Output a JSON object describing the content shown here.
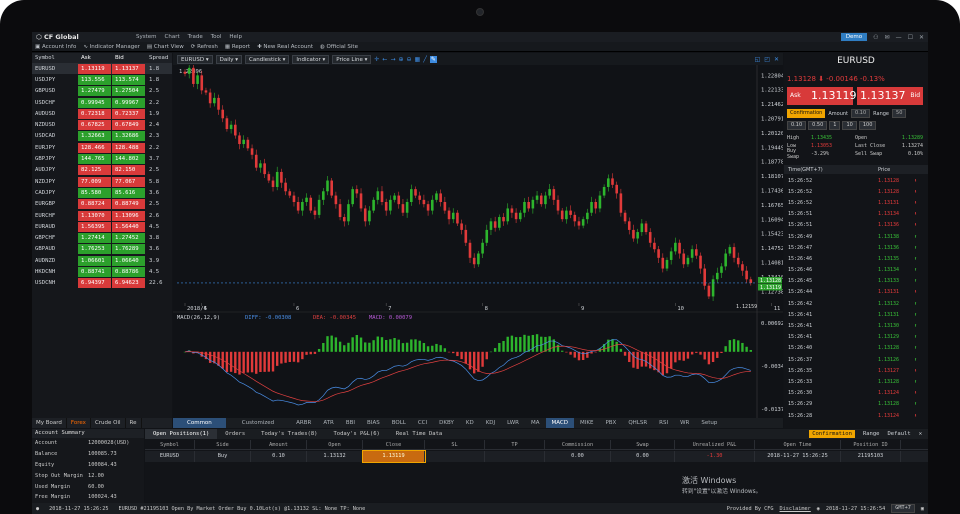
{
  "app": {
    "title": "CF Global"
  },
  "menu": [
    "System",
    "Chart",
    "Trade",
    "Tool",
    "Help"
  ],
  "titlebar_right": {
    "user": "Demo"
  },
  "toolbar": [
    "Account Info",
    "Indicator Manager",
    "Chart View",
    "Refresh",
    "Report",
    "New Real Account",
    "Official Site"
  ],
  "quotes": {
    "headers": {
      "symbol": "Symbol",
      "ask": "Ask",
      "bid": "Bid",
      "spread": "Spread"
    },
    "rows": [
      {
        "symbol": "EURUSD",
        "ask": "1.13119",
        "bid": "1.13137",
        "spread": "1.8",
        "dir": "dn"
      },
      {
        "symbol": "USDJPY",
        "ask": "113.556",
        "bid": "113.574",
        "spread": "1.8",
        "dir": "up"
      },
      {
        "symbol": "GBPUSD",
        "ask": "1.27479",
        "bid": "1.27504",
        "spread": "2.5",
        "dir": "up"
      },
      {
        "symbol": "USDCHF",
        "ask": "0.99945",
        "bid": "0.99967",
        "spread": "2.2",
        "dir": "up"
      },
      {
        "symbol": "AUDUSD",
        "ask": "0.72318",
        "bid": "0.72337",
        "spread": "1.9",
        "dir": "dn"
      },
      {
        "symbol": "NZDUSD",
        "ask": "0.67825",
        "bid": "0.67849",
        "spread": "2.4",
        "dir": "dn"
      },
      {
        "symbol": "USDCAD",
        "ask": "1.32663",
        "bid": "1.32686",
        "spread": "2.3",
        "dir": "up"
      },
      {
        "symbol": "EURJPY",
        "ask": "128.466",
        "bid": "128.488",
        "spread": "2.2",
        "dir": "dn"
      },
      {
        "symbol": "GBPJPY",
        "ask": "144.765",
        "bid": "144.802",
        "spread": "3.7",
        "dir": "up"
      },
      {
        "symbol": "AUDJPY",
        "ask": "82.125",
        "bid": "82.150",
        "spread": "2.5",
        "dir": "dn"
      },
      {
        "symbol": "NZDJPY",
        "ask": "77.009",
        "bid": "77.067",
        "spread": "5.8",
        "dir": "dn"
      },
      {
        "symbol": "CADJPY",
        "ask": "85.580",
        "bid": "85.616",
        "spread": "3.6",
        "dir": "up"
      },
      {
        "symbol": "EURGBP",
        "ask": "0.88724",
        "bid": "0.88749",
        "spread": "2.5",
        "dir": "dn"
      },
      {
        "symbol": "EURCHF",
        "ask": "1.13070",
        "bid": "1.13096",
        "spread": "2.6",
        "dir": "dn"
      },
      {
        "symbol": "EURAUD",
        "ask": "1.56395",
        "bid": "1.56440",
        "spread": "4.5",
        "dir": "dn"
      },
      {
        "symbol": "GBPCHF",
        "ask": "1.27414",
        "bid": "1.27452",
        "spread": "3.8",
        "dir": "up"
      },
      {
        "symbol": "GBPAUD",
        "ask": "1.76253",
        "bid": "1.76289",
        "spread": "3.6",
        "dir": "up"
      },
      {
        "symbol": "AUDNZD",
        "ask": "1.06601",
        "bid": "1.06640",
        "spread": "3.9",
        "dir": "up"
      },
      {
        "symbol": "HKDCNH",
        "ask": "0.88741",
        "bid": "0.88786",
        "spread": "4.5",
        "dir": "up"
      },
      {
        "symbol": "USDCNH",
        "ask": "6.94397",
        "bid": "6.94623",
        "spread": "22.6",
        "dir": "dn"
      }
    ],
    "tabs": [
      "My Board",
      "Forex",
      "Crude Oil",
      "Re"
    ]
  },
  "chart_toolbar": {
    "symbol": "EURUSD",
    "period": "Daily",
    "style": "Candlestick",
    "indicator": "Indicator",
    "price_line": "Price Line"
  },
  "chart_data": {
    "type": "candlestick",
    "start_label": "1.22896",
    "yticks": [
      "1.22804",
      "1.22133",
      "1.21462",
      "1.20791",
      "1.20120",
      "1.19449",
      "1.18778",
      "1.18107",
      "1.17436",
      "1.16765",
      "1.16094",
      "1.15423",
      "1.14752",
      "1.14081",
      "1.13410",
      "1.12738"
    ],
    "ylim": [
      1.12195,
      1.23096
    ],
    "xticks": [
      {
        "label": "2018/4",
        "i": 0
      },
      {
        "label": "5",
        "i": 4
      },
      {
        "label": "6",
        "i": 26
      },
      {
        "label": "7",
        "i": 48
      },
      {
        "label": "8",
        "i": 71
      },
      {
        "label": "9",
        "i": 94
      },
      {
        "label": "10",
        "i": 117
      },
      {
        "label": "11",
        "i": 140
      }
    ],
    "current_price_tags": [
      "1.13128",
      "1.13119"
    ],
    "low_label": "1.12159",
    "closes": [
      1.2287,
      1.2315,
      1.224,
      1.228,
      1.221,
      1.22,
      1.215,
      1.2175,
      1.212,
      1.208,
      1.203,
      1.205,
      1.2,
      1.196,
      1.198,
      1.194,
      1.191,
      1.185,
      1.187,
      1.182,
      1.179,
      1.176,
      1.183,
      1.178,
      1.174,
      1.172,
      1.169,
      1.165,
      1.169,
      1.171,
      1.165,
      1.163,
      1.17,
      1.174,
      1.179,
      1.172,
      1.168,
      1.162,
      1.16,
      1.168,
      1.175,
      1.173,
      1.166,
      1.16,
      1.165,
      1.17,
      1.174,
      1.169,
      1.165,
      1.17,
      1.172,
      1.168,
      1.164,
      1.169,
      1.175,
      1.172,
      1.17,
      1.168,
      1.165,
      1.17,
      1.173,
      1.169,
      1.165,
      1.161,
      1.164,
      1.159,
      1.156,
      1.15,
      1.143,
      1.14,
      1.145,
      1.15,
      1.156,
      1.16,
      1.157,
      1.162,
      1.16,
      1.166,
      1.164,
      1.161,
      1.164,
      1.169,
      1.166,
      1.17,
      1.172,
      1.168,
      1.172,
      1.175,
      1.17,
      1.165,
      1.161,
      1.165,
      1.163,
      1.16,
      1.158,
      1.161,
      1.164,
      1.169,
      1.166,
      1.172,
      1.176,
      1.18,
      1.177,
      1.173,
      1.164,
      1.16,
      1.156,
      1.152,
      1.155,
      1.159,
      1.155,
      1.15,
      1.147,
      1.143,
      1.138,
      1.142,
      1.146,
      1.15,
      1.145,
      1.14,
      1.143,
      1.147,
      1.144,
      1.138,
      1.13,
      1.125,
      1.133,
      1.136,
      1.139,
      1.145,
      1.148,
      1.143,
      1.14,
      1.137,
      1.133,
      1.1313
    ],
    "macd": {
      "label": "MACD(26,12,9)",
      "dif": "DIFF: -0.00308",
      "dea": "DEA: -0.00345",
      "macd": "MACD: 0.00079",
      "yticks": [
        "0.00692",
        "-0.00341",
        "-0.01374"
      ]
    }
  },
  "indicator_tabs": [
    "Common",
    "Customized",
    "ARBR",
    "ATR",
    "BBI",
    "BIAS",
    "BOLL",
    "CCI",
    "DKBY",
    "KD",
    "KDJ",
    "LWR",
    "MA",
    "MACD",
    "MIKE",
    "PBX",
    "QHLSR",
    "RSI",
    "WR",
    "Setup"
  ],
  "right_panel": {
    "symbol": "EURUSD",
    "price": "1.13128",
    "change": "-0.00146",
    "pct": "-0.13%",
    "ask_label": "Ask",
    "ask_price": "1.13119",
    "bid_label": "Bid",
    "bid_price": "1.13137",
    "confirmation": "Confirmation",
    "amount_label": "Amount",
    "amount": "0.10",
    "range_label": "Range",
    "range": "50",
    "lots": [
      "0.10",
      "0.50",
      "1",
      "10",
      "100"
    ],
    "stats": [
      {
        "l": "High",
        "v": "1.13435",
        "l2": "Open",
        "v2": "1.13289"
      },
      {
        "l": "Low",
        "v": "1.13053",
        "l2": "Last Close",
        "v2": "1.13274"
      },
      {
        "l": "Buy Swap",
        "v": "-3.29%",
        "l2": "Sell Swap",
        "v2": "0.10%"
      }
    ],
    "tick_head": {
      "time": "Time(GMT+7)",
      "price": "Price"
    },
    "ticks": [
      {
        "t": "15:26:52",
        "p": "1.13128",
        "d": "dn"
      },
      {
        "t": "15:26:52",
        "p": "1.13128",
        "d": "dn"
      },
      {
        "t": "15:26:52",
        "p": "1.13131",
        "d": "dn"
      },
      {
        "t": "15:26:51",
        "p": "1.13134",
        "d": "dn"
      },
      {
        "t": "15:26:51",
        "p": "1.13136",
        "d": "dn"
      },
      {
        "t": "15:26:49",
        "p": "1.13138",
        "d": "up"
      },
      {
        "t": "15:26:47",
        "p": "1.13136",
        "d": "up"
      },
      {
        "t": "15:26:46",
        "p": "1.13135",
        "d": "up"
      },
      {
        "t": "15:26:46",
        "p": "1.13134",
        "d": "up"
      },
      {
        "t": "15:26:45",
        "p": "1.13133",
        "d": "up"
      },
      {
        "t": "15:26:44",
        "p": "1.13131",
        "d": "dn"
      },
      {
        "t": "15:26:42",
        "p": "1.13132",
        "d": "up"
      },
      {
        "t": "15:26:41",
        "p": "1.13131",
        "d": "up"
      },
      {
        "t": "15:26:41",
        "p": "1.13130",
        "d": "up"
      },
      {
        "t": "15:26:41",
        "p": "1.13129",
        "d": "up"
      },
      {
        "t": "15:26:40",
        "p": "1.13128",
        "d": "up"
      },
      {
        "t": "15:26:37",
        "p": "1.13126",
        "d": "up"
      },
      {
        "t": "15:26:35",
        "p": "1.13127",
        "d": "dn"
      },
      {
        "t": "15:26:33",
        "p": "1.13128",
        "d": "up"
      },
      {
        "t": "15:26:30",
        "p": "1.13124",
        "d": "dn"
      },
      {
        "t": "15:26:29",
        "p": "1.13128",
        "d": "up"
      },
      {
        "t": "15:26:28",
        "p": "1.13124",
        "d": "dn"
      }
    ]
  },
  "account": {
    "title": "Account Summary",
    "rows": [
      {
        "l": "Account",
        "v": "12000028(USD)",
        "neg": false
      },
      {
        "l": "Balance",
        "v": "100085.73",
        "neg": false
      },
      {
        "l": "Equity",
        "v": "100084.43",
        "neg": false
      },
      {
        "l": "Stop Out Margin",
        "v": "12.00",
        "neg": false
      },
      {
        "l": "Used Margin",
        "v": "60.00",
        "neg": false
      },
      {
        "l": "Free Margin",
        "v": "100024.43",
        "neg": false
      },
      {
        "l": "Net Floating P&L",
        "v": "-1.30",
        "neg": true
      },
      {
        "l": "Margin %",
        "v": "166807.38%",
        "neg": false
      }
    ]
  },
  "positions": {
    "tabs": [
      "Open Positions(1)",
      "Orders",
      "Today's Trades(8)",
      "Today's P&L(6)",
      "Real Time Data"
    ],
    "right": {
      "confirmation": "Confirmation",
      "range": "Range",
      "default": "Default"
    },
    "headers": [
      "Symbol",
      "Side",
      "Amount",
      "Open",
      "Close",
      "SL",
      "TP",
      "Commission",
      "Swap",
      "Unrealized P&L",
      "Open Time",
      "Position ID"
    ],
    "row": [
      "EURUSD",
      "Buy",
      "0.10",
      "1.13132",
      "1.13119",
      "",
      "",
      "0.00",
      "0.00",
      "-1.30",
      "2018-11-27 15:26:25",
      "21195103"
    ]
  },
  "watermark": {
    "line1": "激活 Windows",
    "line2": "转到\"设置\"以激活 Windows。"
  },
  "status": {
    "left": "2018-11-27 15:26:25",
    "msg": "EURUSD #21195103 Open By Market Order Buy 0.10Lot(s) @1.13132  SL: None  TP: None",
    "provided": "Provided By CFG",
    "disclaimer": "Disclaimer",
    "time": "2018-11-27 15:26:54",
    "gmt": "GMT+7"
  }
}
